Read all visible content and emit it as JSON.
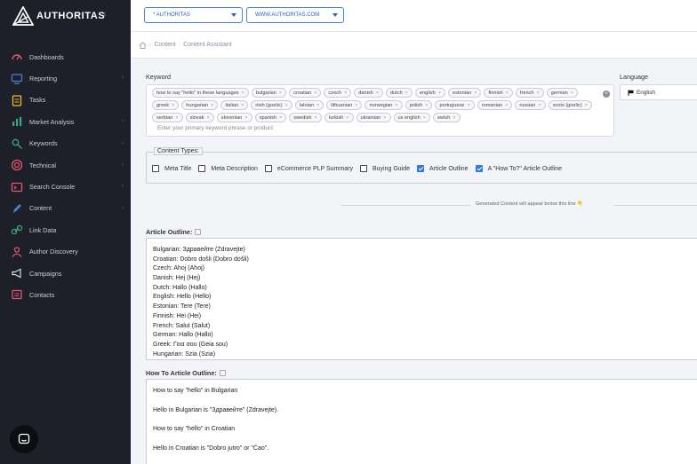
{
  "app": {
    "name": "AUTHORITAS"
  },
  "topbar": {
    "project": "* AUTHORITAS",
    "domain": "WWW.AUTHORITAS.COM"
  },
  "breadcrumb": {
    "sep": "·",
    "level1": "Content",
    "level2": "Content Assistant"
  },
  "sidebar": {
    "items": [
      {
        "label": "Dashboards",
        "icon": "gauge-icon",
        "color": "#e8556b",
        "arrow": false
      },
      {
        "label": "Reporting",
        "icon": "monitor-icon",
        "color": "#4a7fd6",
        "arrow": true
      },
      {
        "label": "Tasks",
        "icon": "clipboard-icon",
        "color": "#f2b830",
        "arrow": false
      },
      {
        "label": "Market Analysis",
        "icon": "bar-chart-icon",
        "color": "#3aa878",
        "arrow": true
      },
      {
        "label": "Keywords",
        "icon": "keywords-icon",
        "color": "#3aa878",
        "arrow": true
      },
      {
        "label": "Technical",
        "icon": "target-icon",
        "color": "#e8556b",
        "arrow": true
      },
      {
        "label": "Search Console",
        "icon": "console-icon",
        "color": "#e8556b",
        "arrow": true
      },
      {
        "label": "Content",
        "icon": "content-icon",
        "color": "#4a7fd6",
        "arrow": true
      },
      {
        "label": "Link Data",
        "icon": "link-icon",
        "color": "#3aa878",
        "arrow": false
      },
      {
        "label": "Author Discovery",
        "icon": "author-icon",
        "color": "#e8556b",
        "arrow": false
      },
      {
        "label": "Campaigns",
        "icon": "megaphone-icon",
        "color": "#d8dbe3",
        "arrow": false
      },
      {
        "label": "Contacts",
        "icon": "contacts-icon",
        "color": "#e8556b",
        "arrow": false
      }
    ]
  },
  "keyword": {
    "label": "Keyword",
    "chips": [
      "how to say \"hello\" in these languages",
      "bulgarian",
      "croatian",
      "czech",
      "danish",
      "dutch",
      "english",
      "estonian",
      "finnish",
      "french",
      "german",
      "greek",
      "hungarian",
      "italian",
      "irish (goelic)",
      "latvian",
      "lithuanian",
      "norwegian",
      "polish",
      "portuguese",
      "romanian",
      "russian",
      "scots (goelic)",
      "serbian",
      "slovak",
      "slovenian",
      "spanish",
      "swedish",
      "turkish",
      "ukrainian",
      "us english",
      "welsh"
    ],
    "placeholder": "Enter your primary keyword phrase or product"
  },
  "language": {
    "label": "Language",
    "value": "English"
  },
  "content_types": {
    "legend": "Content Types:",
    "options": [
      {
        "label": "Meta Title",
        "checked": false
      },
      {
        "label": "Meta Description",
        "checked": false
      },
      {
        "label": "eCommerce PLP Summary",
        "checked": false
      },
      {
        "label": "Buying Guide",
        "checked": false
      },
      {
        "label": "Article Outline",
        "checked": true
      },
      {
        "label": "A \"How To?\" Article Outline",
        "checked": true
      }
    ]
  },
  "generated_note": "Generated Content will appear below this line 👇",
  "article_outline": {
    "title": "Article Outline:",
    "lines": [
      "Bulgarian: Здравейте (Zdravejte)",
      "Croatian: Dobro došli (Dobro došli)",
      "Czech: Ahoj (Ahoj)",
      "Danish: Hej (Hej)",
      "Dutch: Hallo (Hallo)",
      "English: Hello (Hello)",
      "Estonian: Tere (Tere)",
      "Finnish: Hei (Hei)",
      "French: Salut (Salut)",
      "German: Hallo (Hallo)",
      "Greek: Γεια σου (Geia sou)",
      "Hungarian: Szia (Szia)"
    ]
  },
  "howto_outline": {
    "title": "How To Article Outline:",
    "lines": [
      "How to say \"hello\" in Bulgarian",
      "Hello in Bulgarian is \"Здравейте\" (Zdravejte).",
      "How to say \"hello\" in Croatian",
      "Hello in Croatian is \"Dobro jutro\" or \"Ćao\"."
    ]
  }
}
